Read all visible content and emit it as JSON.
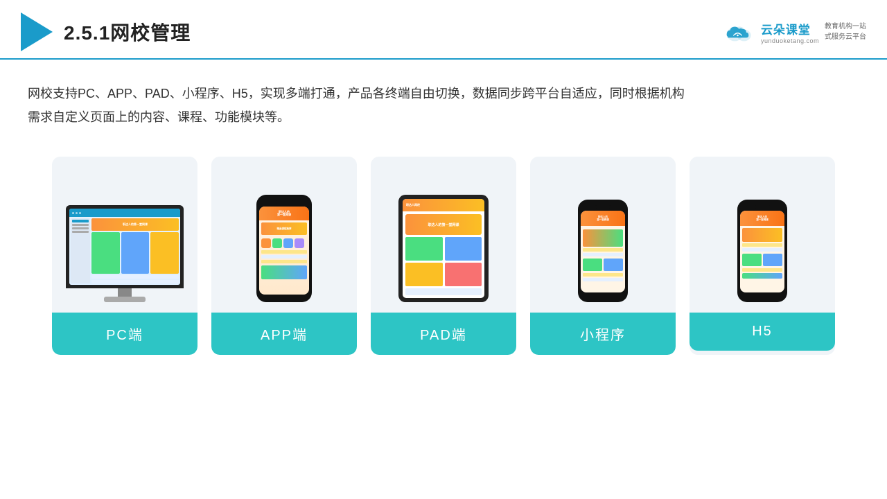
{
  "header": {
    "title": "2.5.1网校管理",
    "brand": {
      "name": "云朵课堂",
      "url": "yunduoketang.com",
      "tagline": "教育机构一站\n式服务云平台"
    }
  },
  "description": {
    "text": "网校支持PC、APP、PAD、小程序、H5，实现多端打通，产品各终端自由切换，数据同步跨平台自适应，同时根据机构\n需求自定义页面上的内容、课程、功能模块等。"
  },
  "cards": [
    {
      "id": "pc",
      "label": "PC端"
    },
    {
      "id": "app",
      "label": "APP端"
    },
    {
      "id": "pad",
      "label": "PAD端"
    },
    {
      "id": "miniprogram",
      "label": "小程序"
    },
    {
      "id": "h5",
      "label": "H5"
    }
  ],
  "colors": {
    "accent": "#1a9bca",
    "card_label_bg": "#2dc5c5",
    "card_bg": "#f0f4f8",
    "text_primary": "#222",
    "text_body": "#333"
  }
}
